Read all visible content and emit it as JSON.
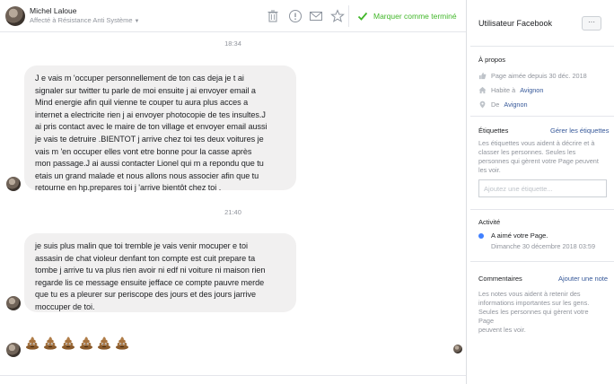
{
  "header": {
    "name": "Michel Laloue",
    "subtitle": "Affecté à Résistance Anti Système",
    "done_label": "Marquer comme terminé"
  },
  "conversation": {
    "time1": "18:34",
    "time2": "21:40",
    "message1": "J e vais m 'occuper personnellement de ton cas deja je t ai\nsignaler sur twitter tu parle de moi ensuite j ai envoyer email a\nMind energie afin quil vienne te couper tu aura plus acces a\ninternet a electricite rien j ai envoyer photocopie de tes insultes.J\nai pris contact avec le maire de ton village et envoyer email aussi\nje vais te detruire  .BIENTOT j arrive chez toi tes deux voitures je\nvais m 'en occuper elles vont etre bonne pour la casse  après\nmon passage.J ai aussi contacter Lionel qui m  a repondu que tu\netais un grand malade et nous allons nous associer afin que tu\nretourne en hp.prepares toi j 'arrive bientôt chez toi .",
    "message2": "je suis plus malin que toi tremble je vais venir mocuper e toi\nassasin de chat violeur denfant ton compte est cuit prepare ta\ntombe j arrive tu va plus rien avoir ni edf ni voiture ni maison rien\nregarde lis ce message ensuite jefface ce compte pauvre merde\nque tu es a pleurer sur periscope des jours et des jours jarrive\nmoccuper de toi.",
    "emoji_count": 6,
    "emoji_icon": "poop-emoji"
  },
  "sidebar": {
    "user_title": "Utilisateur Facebook",
    "more_label": "···",
    "about": {
      "heading": "À propos",
      "liked": "Page aimée depuis 30 déc. 2018",
      "lives_prefix": "Habite à",
      "lives_city": "Avignon",
      "from_prefix": "De",
      "from_city": "Avignon"
    },
    "labels": {
      "heading": "Étiquettes",
      "manage": "Gérer les étiquettes",
      "description": "Les étiquettes vous aident à décrire et à\nclasser les personnes. Seules les\npersonnes qui gèrent votre Page peuvent\nles voir.",
      "placeholder": "Ajoutez une étiquette..."
    },
    "activity": {
      "heading": "Activité",
      "item": "A aimé votre Page.",
      "date": "Dimanche 30 décembre 2018 03:59",
      "dot_color": "#4080ff"
    },
    "notes": {
      "heading": "Commentaires",
      "add": "Ajouter une note",
      "description": "Les notes vous aident à retenir des\ninformations importantes sur les gens.\nSeules les personnes qui gèrent votre Page\npeuvent les voir."
    }
  },
  "colors": {
    "done_green": "#42b72a",
    "link_blue": "#365899",
    "bubble_bg": "#f1f0f0"
  }
}
